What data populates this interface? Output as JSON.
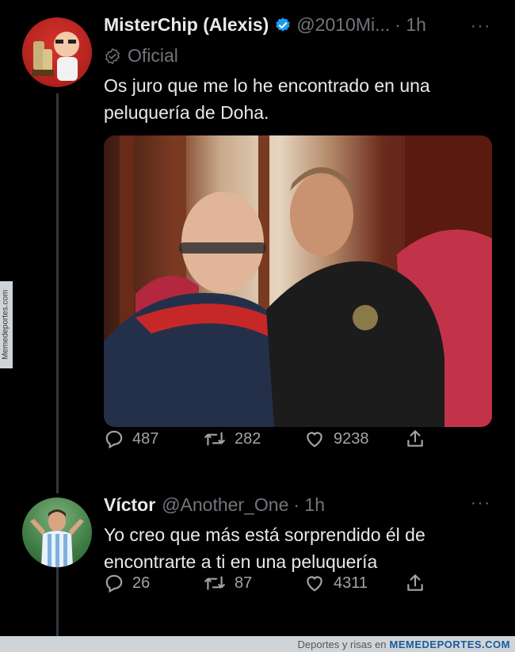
{
  "tweet1": {
    "display_name": "MisterChip (Alexis)",
    "handle": "@2010Mi...",
    "time": "· 1h",
    "badge_label": "Oficial",
    "text": "Os juro que me lo he encontrado en una peluquería de Doha.",
    "replies": "487",
    "retweets": "282",
    "likes": "9238"
  },
  "tweet2": {
    "display_name": "Víctor",
    "handle": "@Another_One",
    "time": "· 1h",
    "text": "Yo creo que más está sorprendido él de encontrarte a ti en una peluquería",
    "replies": "26",
    "retweets": "87",
    "likes": "4311"
  },
  "more_label": "···",
  "watermark": "Memedeportes.com",
  "footer": {
    "prefix": "Deportes y risas en",
    "brand": "MEMEDEPORTES.COM"
  },
  "colors": {
    "background": "#000000",
    "text": "#e7e9ea",
    "muted": "#71767b",
    "verified": "#1d9bf0"
  },
  "icons": [
    "verified-icon",
    "official-badge-icon",
    "reply-icon",
    "retweet-icon",
    "like-icon",
    "share-icon",
    "more-icon"
  ]
}
